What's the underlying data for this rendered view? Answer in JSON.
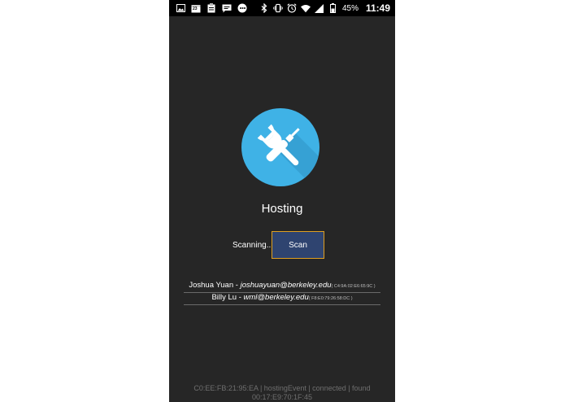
{
  "status_bar": {
    "left_icons": [
      "image-icon",
      "calendar-icon",
      "clipboard-icon",
      "message-icon",
      "chat-icon"
    ],
    "calendar_day": "23",
    "right_icons": [
      "bluetooth-icon",
      "vibrate-icon",
      "alarm-icon",
      "wifi-icon",
      "signal-icon",
      "battery-icon"
    ],
    "battery_percent": "45%",
    "time": "11:49"
  },
  "app": {
    "logo_icon": "wrench-screwdriver-icon",
    "logo_color": "#3fb2e6",
    "title": "Hosting"
  },
  "scan": {
    "status_text": "Scanning...",
    "button_label": "Scan",
    "button_color": "#2f4470",
    "button_border_color": "#e0a020"
  },
  "devices": [
    {
      "name": "Joshua Yuan",
      "separator": " - ",
      "email": "joshuayuan@berkeley.edu",
      "mac": "( C4:9A:02:E6:65:9C )"
    },
    {
      "name": "Billy Lu",
      "separator": " - ",
      "email": "wml@berkeley.edu",
      "mac": "( F8:E0:79:26:58:DC )"
    }
  ],
  "footer": {
    "text": "C0:EE:FB:21:95:EA | hostingEvent | connected | found 00:17:E9:70:1F:45"
  }
}
